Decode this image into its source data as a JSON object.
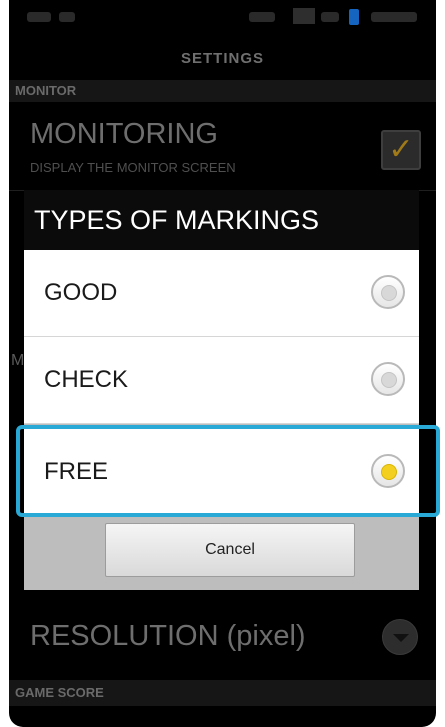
{
  "titlebar": {
    "title": "SETTINGS"
  },
  "monitor_section": {
    "header": "MONITOR",
    "monitoring": {
      "title": "MONITORING",
      "description": "DISPLAY THE MONITOR SCREEN",
      "checked": true
    },
    "partial_letter": "M"
  },
  "resolution": {
    "title": "RESOLUTION (pixel)",
    "icon": "chevron-down-icon"
  },
  "game_score_section": {
    "header": "GAME SCORE"
  },
  "dialog": {
    "title": "TYPES OF MARKINGS",
    "options": [
      {
        "label": "GOOD",
        "selected": false
      },
      {
        "label": "CHECK",
        "selected": false
      },
      {
        "label": "FREE",
        "selected": true
      }
    ],
    "cancel_label": "Cancel"
  },
  "colors": {
    "highlight": "#29a9d6",
    "radio_selected": "#f3cf1f",
    "checkmark": "#a07a18"
  }
}
